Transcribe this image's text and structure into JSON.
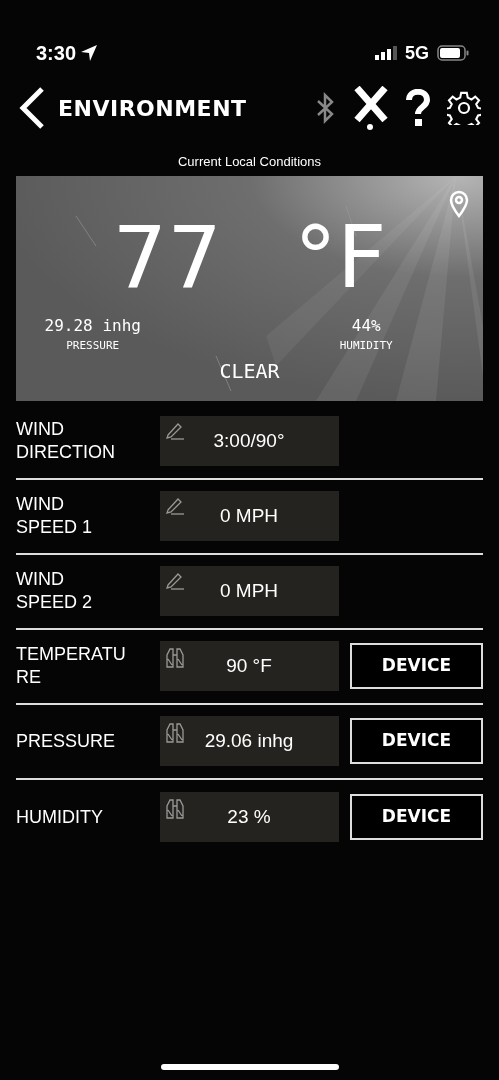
{
  "status_bar": {
    "time": "3:30",
    "network": "5G"
  },
  "header": {
    "title": "ENVIRONMENT"
  },
  "conditions": {
    "caption": "Current Local Conditions",
    "temperature": "77",
    "unit": "°F",
    "pressure": "29.28 inhg",
    "pressure_label": "PRESSURE",
    "humidity": "44%",
    "humidity_label": "HUMIDITY",
    "sky": "CLEAR"
  },
  "rows": [
    {
      "label": "WIND DIRECTION",
      "kind": "manual",
      "value": "3:00/90°"
    },
    {
      "label": "WIND SPEED 1",
      "kind": "manual",
      "value": "0 MPH"
    },
    {
      "label": "WIND SPEED 2",
      "kind": "manual",
      "value": "0 MPH"
    },
    {
      "label": "TEMPERATURE",
      "kind": "device",
      "value": "90 °F",
      "button": "DEVICE"
    },
    {
      "label": "PRESSURE",
      "kind": "device",
      "value": "29.06 inhg",
      "button": "DEVICE"
    },
    {
      "label": "HUMIDITY",
      "kind": "device",
      "value": "23 %",
      "button": "DEVICE"
    }
  ]
}
